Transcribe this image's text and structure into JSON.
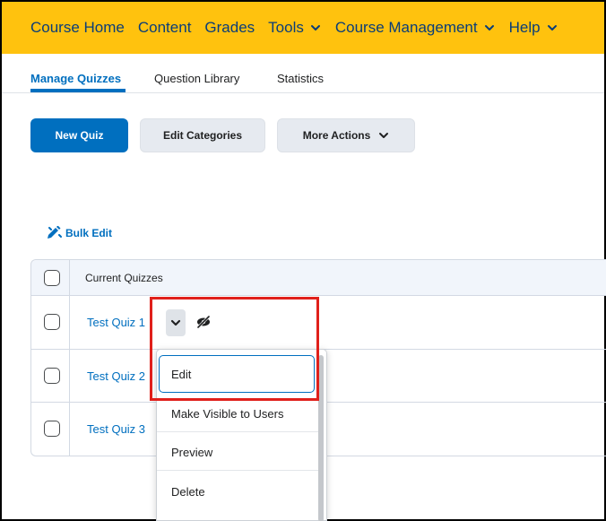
{
  "colors": {
    "navbar_bg": "#ffc20e",
    "primary": "#006fbf",
    "link": "#006fbf",
    "highlight": "#e0201b"
  },
  "navbar": {
    "items": [
      {
        "label": "Course Home"
      },
      {
        "label": "Content"
      },
      {
        "label": "Grades"
      },
      {
        "label": "Tools",
        "icon": "chevron-down-icon"
      },
      {
        "label": "Course Management",
        "icon": "chevron-down-icon"
      },
      {
        "label": "Help",
        "icon": "chevron-down-icon"
      }
    ]
  },
  "tabs": [
    {
      "label": "Manage Quizzes",
      "active": true
    },
    {
      "label": "Question Library"
    },
    {
      "label": "Statistics"
    }
  ],
  "toolbar": {
    "new_quiz": "New Quiz",
    "edit_categories": "Edit Categories",
    "more_actions": "More Actions"
  },
  "bulk_edit": {
    "label": "Bulk Edit",
    "icon": "pencil-icon"
  },
  "table": {
    "header": "Current Quizzes",
    "rows": [
      {
        "name": "Test Quiz 1"
      },
      {
        "name": "Test Quiz 2"
      },
      {
        "name": "Test Quiz 3"
      }
    ]
  },
  "context_menu": {
    "items": [
      {
        "label": "Edit"
      },
      {
        "label": "Make Visible to Users"
      },
      {
        "label": "Preview"
      },
      {
        "label": "Delete"
      }
    ]
  },
  "icons": {
    "row_menu": "chevron-down-icon",
    "visibility": "eye-hidden-icon"
  }
}
